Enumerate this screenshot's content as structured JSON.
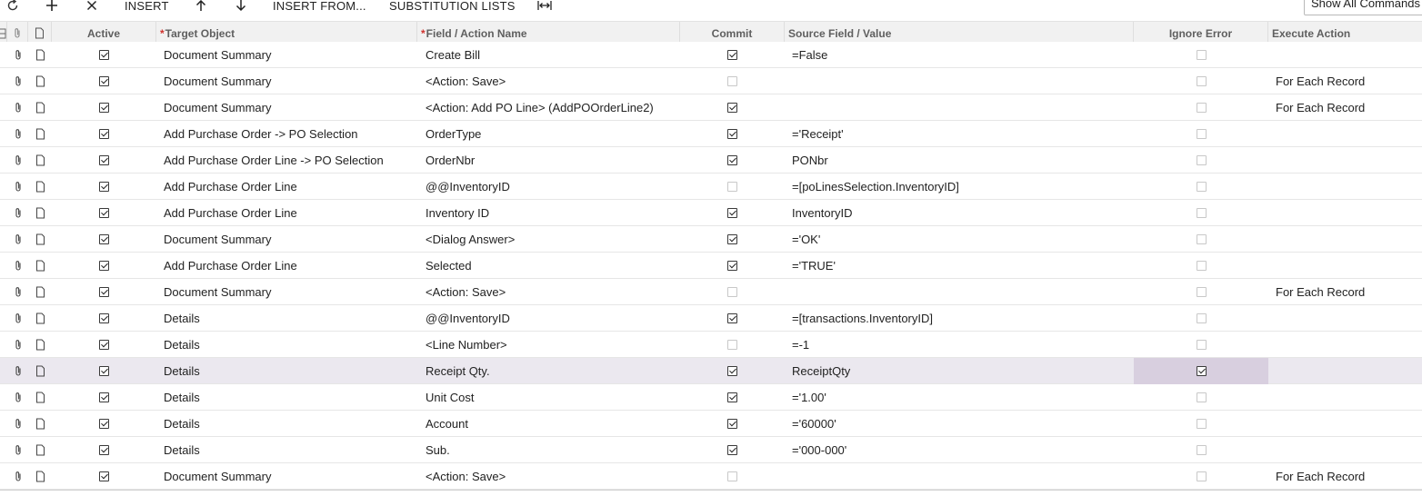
{
  "toolbar": {
    "insert_label": "INSERT",
    "insert_from_label": "INSERT FROM...",
    "substitution_lists_label": "SUBSTITUTION LISTS",
    "show_all_label": "Show All Commands"
  },
  "columns": {
    "active": "Active",
    "target_object": "Target Object",
    "field_action": "Field / Action Name",
    "commit": "Commit",
    "source_value": "Source Field / Value",
    "ignore_error": "Ignore Error",
    "execute_action": "Execute Action",
    "required_mark": "*"
  },
  "rows": [
    {
      "target": "Document Summary",
      "field": "Create Bill",
      "commit": true,
      "source": "=False",
      "ignore": false,
      "execute": ""
    },
    {
      "target": "Document Summary",
      "field": "<Action: Save>",
      "commit": false,
      "source": "",
      "ignore": false,
      "execute": "For Each Record"
    },
    {
      "target": "Document Summary",
      "field": "<Action: Add PO Line> (AddPOOrderLine2)",
      "commit": true,
      "source": "",
      "ignore": false,
      "execute": "For Each Record"
    },
    {
      "target": "Add Purchase Order -> PO Selection",
      "field": "OrderType",
      "commit": true,
      "source": "='Receipt'",
      "ignore": false,
      "execute": ""
    },
    {
      "target": "Add Purchase Order Line -> PO Selection",
      "field": "OrderNbr",
      "commit": true,
      "source": "PONbr",
      "ignore": false,
      "execute": ""
    },
    {
      "target": "Add Purchase Order Line",
      "field": "@@InventoryID",
      "commit": false,
      "source": "=[poLinesSelection.InventoryID]",
      "ignore": false,
      "execute": ""
    },
    {
      "target": "Add Purchase Order Line",
      "field": "Inventory ID",
      "commit": true,
      "source": "InventoryID",
      "ignore": false,
      "execute": ""
    },
    {
      "target": "Document Summary",
      "field": "<Dialog Answer>",
      "commit": true,
      "source": "='OK'",
      "ignore": false,
      "execute": ""
    },
    {
      "target": "Add Purchase Order Line",
      "field": "Selected",
      "commit": true,
      "source": "='TRUE'",
      "ignore": false,
      "execute": ""
    },
    {
      "target": "Document Summary",
      "field": "<Action: Save>",
      "commit": false,
      "source": "",
      "ignore": false,
      "execute": "For Each Record"
    },
    {
      "target": "Details",
      "field": "@@InventoryID",
      "commit": true,
      "source": "=[transactions.InventoryID]",
      "ignore": false,
      "execute": ""
    },
    {
      "target": "Details",
      "field": "<Line Number>",
      "commit": false,
      "source": "=-1",
      "ignore": false,
      "execute": ""
    },
    {
      "target": "Details",
      "field": "Receipt Qty.",
      "commit": true,
      "source": "ReceiptQty",
      "ignore": true,
      "execute": "",
      "selected": true
    },
    {
      "target": "Details",
      "field": "Unit Cost",
      "commit": true,
      "source": "='1.00'",
      "ignore": false,
      "execute": ""
    },
    {
      "target": "Details",
      "field": "Account",
      "commit": true,
      "source": "='60000'",
      "ignore": false,
      "execute": ""
    },
    {
      "target": "Details",
      "field": "Sub.",
      "commit": true,
      "source": "='000-000'",
      "ignore": false,
      "execute": ""
    },
    {
      "target": "Document Summary",
      "field": "<Action: Save>",
      "commit": false,
      "source": "",
      "ignore": false,
      "execute": "For Each Record"
    }
  ]
}
